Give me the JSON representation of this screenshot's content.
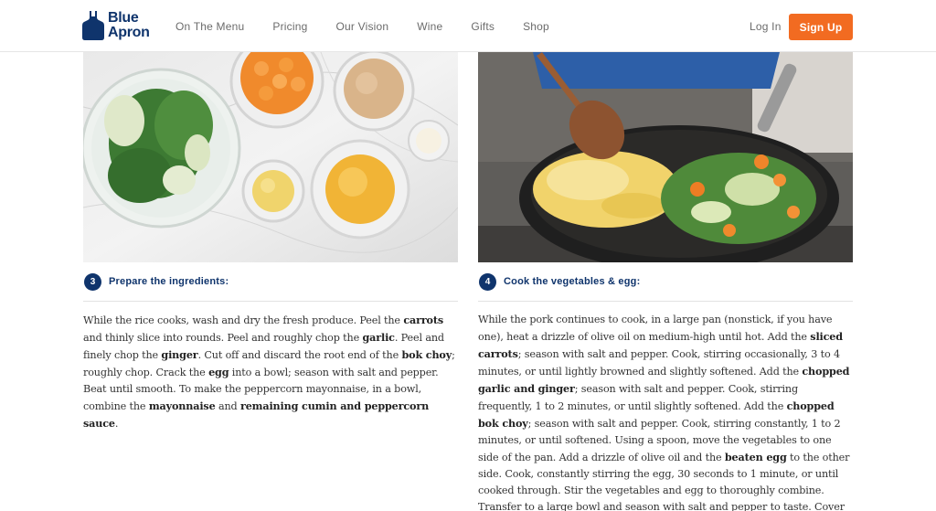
{
  "brand": {
    "line1": "Blue",
    "line2": "Apron",
    "color": "#0f346c"
  },
  "nav": [
    "On The Menu",
    "Pricing",
    "Our Vision",
    "Wine",
    "Gifts",
    "Shop"
  ],
  "header": {
    "login": "Log In",
    "signup": "Sign Up",
    "accent": "#f26b21"
  },
  "steps": [
    {
      "number": "3",
      "title": "Prepare the ingredients:",
      "image": "prepared-ingredients-photo",
      "body": [
        {
          "t": "While the rice cooks, wash and dry the fresh produce. Peel the "
        },
        {
          "t": "carrots",
          "b": true
        },
        {
          "t": " and thinly slice into rounds. Peel and roughly chop the "
        },
        {
          "t": "garlic",
          "b": true
        },
        {
          "t": ". Peel and finely chop the "
        },
        {
          "t": "ginger",
          "b": true
        },
        {
          "t": ". Cut off and discard the root end of the "
        },
        {
          "t": "bok choy",
          "b": true
        },
        {
          "t": "; roughly chop. Crack the "
        },
        {
          "t": "egg",
          "b": true
        },
        {
          "t": " into a bowl; season with salt and pepper. Beat until smooth. To make the peppercorn mayonnaise, in a bowl, combine the "
        },
        {
          "t": "mayonnaise",
          "b": true
        },
        {
          "t": " and "
        },
        {
          "t": "remaining cumin and peppercorn sauce",
          "b": true
        },
        {
          "t": "."
        }
      ]
    },
    {
      "number": "4",
      "title": "Cook the vegetables & egg:",
      "image": "vegetables-in-pan-photo",
      "body": [
        {
          "t": "While the pork continues to cook, in a large pan (nonstick, if you have one), heat a drizzle of olive oil on medium-high until hot. Add the "
        },
        {
          "t": "sliced carrots",
          "b": true
        },
        {
          "t": "; season with salt and pepper. Cook, stirring occasionally, 3 to 4 minutes, or until lightly browned and slightly softened. Add the "
        },
        {
          "t": "chopped garlic and ginger",
          "b": true
        },
        {
          "t": "; season with salt and pepper. Cook, stirring frequently, 1 to 2 minutes, or until slightly softened. Add the "
        },
        {
          "t": "chopped bok choy",
          "b": true
        },
        {
          "t": "; season with salt and pepper. Cook, stirring constantly, 1 to 2 minutes, or until softened. Using a spoon, move the vegetables to one side of the pan. Add a drizzle of olive oil and the "
        },
        {
          "t": "beaten egg",
          "b": true
        },
        {
          "t": " to the other side. Cook, constantly stirring the egg, 30 seconds to 1 minute, or until cooked through. Stir the vegetables and egg to thoroughly combine. Transfer to a large bowl and season with salt and pepper to taste. Cover with aluminum foil to keep warm. Wipe out the pan."
        }
      ]
    }
  ]
}
